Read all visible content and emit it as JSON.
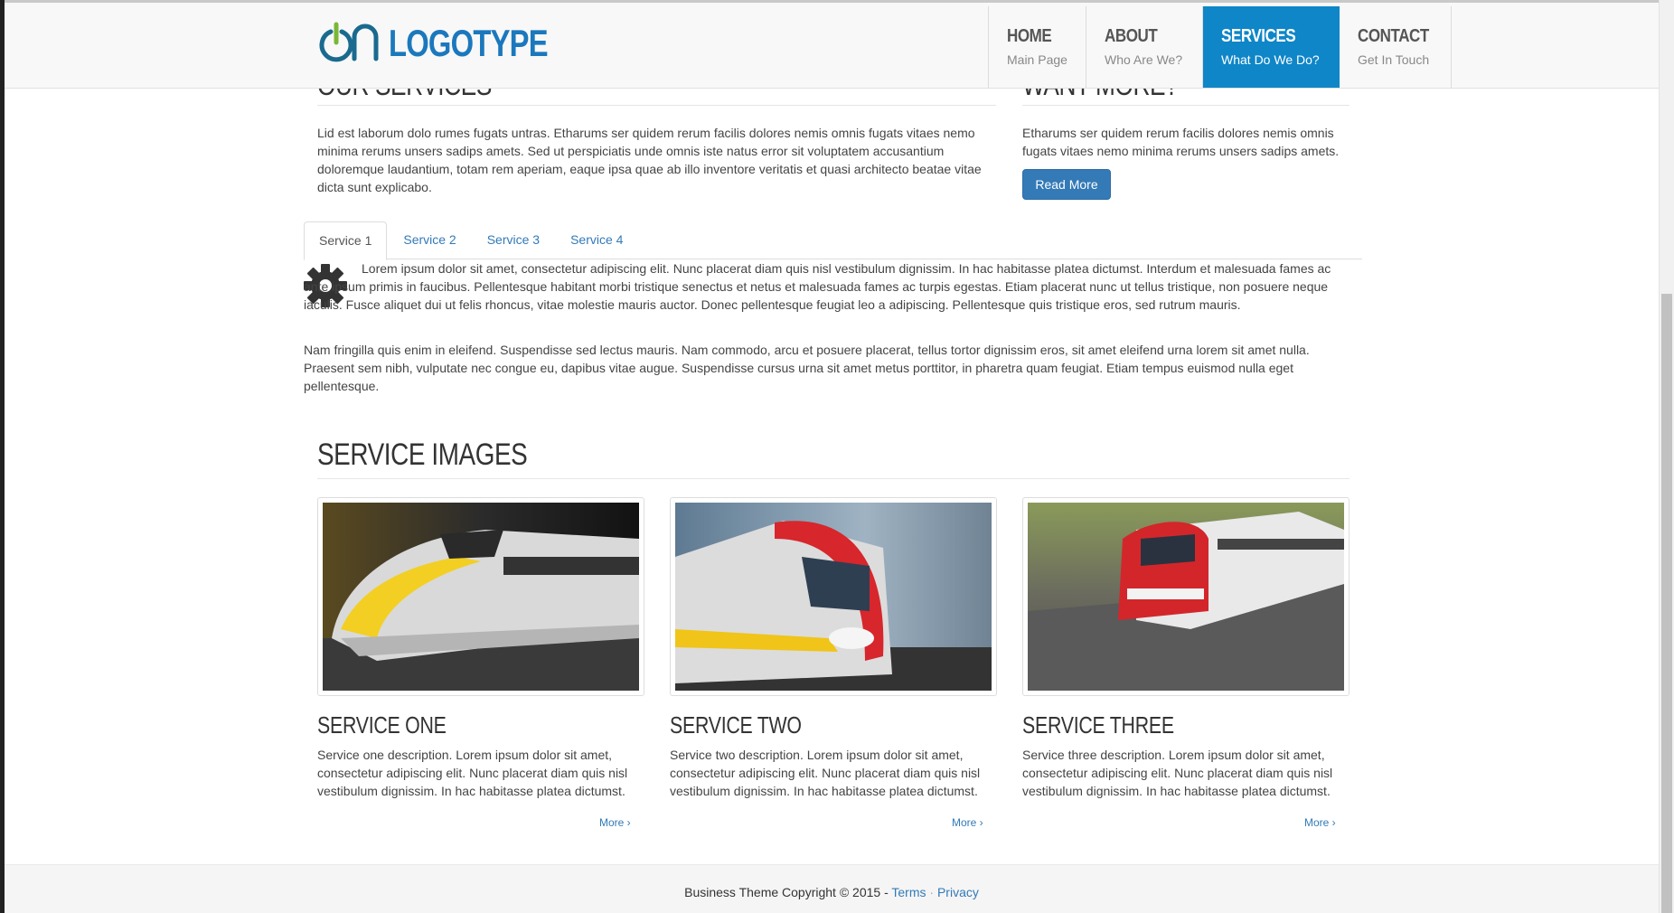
{
  "header": {
    "logo_text": "LOGOTYPE",
    "nav": [
      {
        "title": "HOME",
        "subtitle": "Main Page"
      },
      {
        "title": "ABOUT",
        "subtitle": "Who Are We?"
      },
      {
        "title": "SERVICES",
        "subtitle": "What Do We Do?"
      },
      {
        "title": "CONTACT",
        "subtitle": "Get In Touch"
      }
    ],
    "active_nav": "SERVICES"
  },
  "our_services": {
    "heading": "OUR SERVICES",
    "text": "Lid est laborum dolo rumes fugats untras. Etharums ser quidem rerum facilis dolores nemis omnis fugats vitaes nemo minima rerums unsers sadips amets. Sed ut perspiciatis unde omnis iste natus error sit voluptatem accusantium doloremque laudantium, totam rem aperiam, eaque ipsa quae ab illo inventore veritatis et quasi architecto beatae vitae dicta sunt explicabo."
  },
  "want_more": {
    "heading": "WANT MORE?",
    "text": "Etharums ser quidem rerum facilis dolores nemis omnis fugats vitaes nemo minima rerums unsers sadips amets.",
    "button": "Read More"
  },
  "tabs": {
    "items": [
      "Service 1",
      "Service 2",
      "Service 3",
      "Service 4"
    ],
    "active": "Service 1",
    "icon": "gear-icon",
    "paragraph1": "Lorem ipsum dolor sit amet, consectetur adipiscing elit. Nunc placerat diam quis nisl vestibulum dignissim. In hac habitasse platea dictumst. Interdum et malesuada fames ac ante ipsum primis in faucibus. Pellentesque habitant morbi tristique senectus et netus et malesuada fames ac turpis egestas. Etiam placerat nunc ut tellus tristique, non posuere neque iaculis. Fusce aliquet dui ut felis rhoncus, vitae molestie mauris auctor. Donec pellentesque feugiat leo a adipiscing. Pellentesque quis tristique eros, sed rutrum mauris.",
    "paragraph2": "Nam fringilla quis enim in eleifend. Suspendisse sed lectus mauris. Nam commodo, arcu et posuere placerat, tellus tortor dignissim eros, sit amet eleifend urna lorem sit amet nulla. Praesent sem nibh, vulputate nec congue eu, dapibus vitae augue. Suspendisse cursus urna sit amet metus porttitor, in pharetra quam feugiat. Etiam tempus euismod nulla eget pellentesque."
  },
  "service_images": {
    "heading": "SERVICE IMAGES",
    "cards": [
      {
        "title": "SERVICE ONE",
        "desc": "Service one description. Lorem ipsum dolor sit amet, consectetur adipiscing elit. Nunc placerat diam quis nisl vestibulum dignissim. In hac habitasse platea dictumst.",
        "more": "More ›"
      },
      {
        "title": "SERVICE TWO",
        "desc": "Service two description. Lorem ipsum dolor sit amet, consectetur adipiscing elit. Nunc placerat diam quis nisl vestibulum dignissim. In hac habitasse platea dictumst.",
        "more": "More ›"
      },
      {
        "title": "SERVICE THREE",
        "desc": "Service three description. Lorem ipsum dolor sit amet, consectetur adipiscing elit. Nunc placerat diam quis nisl vestibulum dignissim. In hac habitasse platea dictumst.",
        "more": "More ›"
      }
    ]
  },
  "footer": {
    "copyright": "Business Theme Copyright © 2015 -",
    "terms": "Terms",
    "separator": "·",
    "privacy": "Privacy"
  },
  "colors": {
    "accent": "#0f86c8",
    "link": "#337ab7",
    "button": "#337ab7"
  }
}
